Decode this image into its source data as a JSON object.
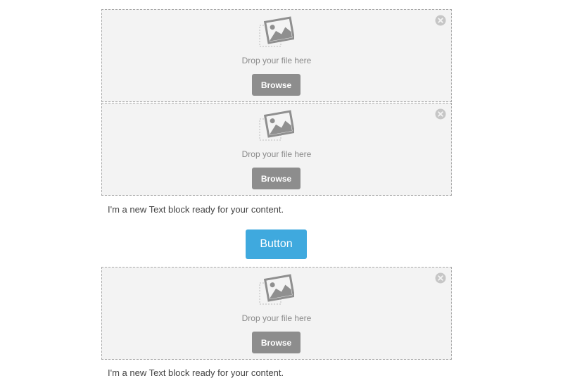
{
  "blocks": [
    {
      "drop_text": "Drop your file here",
      "browse_label": "Browse",
      "icons": {
        "remove": "close-circle-icon",
        "placeholder": "image-placeholder-icon"
      }
    },
    {
      "drop_text": "Drop your file here",
      "browse_label": "Browse",
      "icons": {
        "remove": "close-circle-icon",
        "placeholder": "image-placeholder-icon"
      }
    },
    {
      "text": "I'm a new Text block ready for your content."
    },
    {
      "button_label": "Button"
    },
    {
      "drop_text": "Drop your file here",
      "browse_label": "Browse",
      "icons": {
        "remove": "close-circle-icon",
        "placeholder": "image-placeholder-icon"
      }
    },
    {
      "text": "I'm a new Text block ready for your content."
    }
  ],
  "colors": {
    "dropzone_bg": "#f3f3f3",
    "dropzone_border": "#a8a8a8",
    "browse_bg": "#8d8d8d",
    "button_bg": "#3fa9de",
    "text": "#444444"
  }
}
